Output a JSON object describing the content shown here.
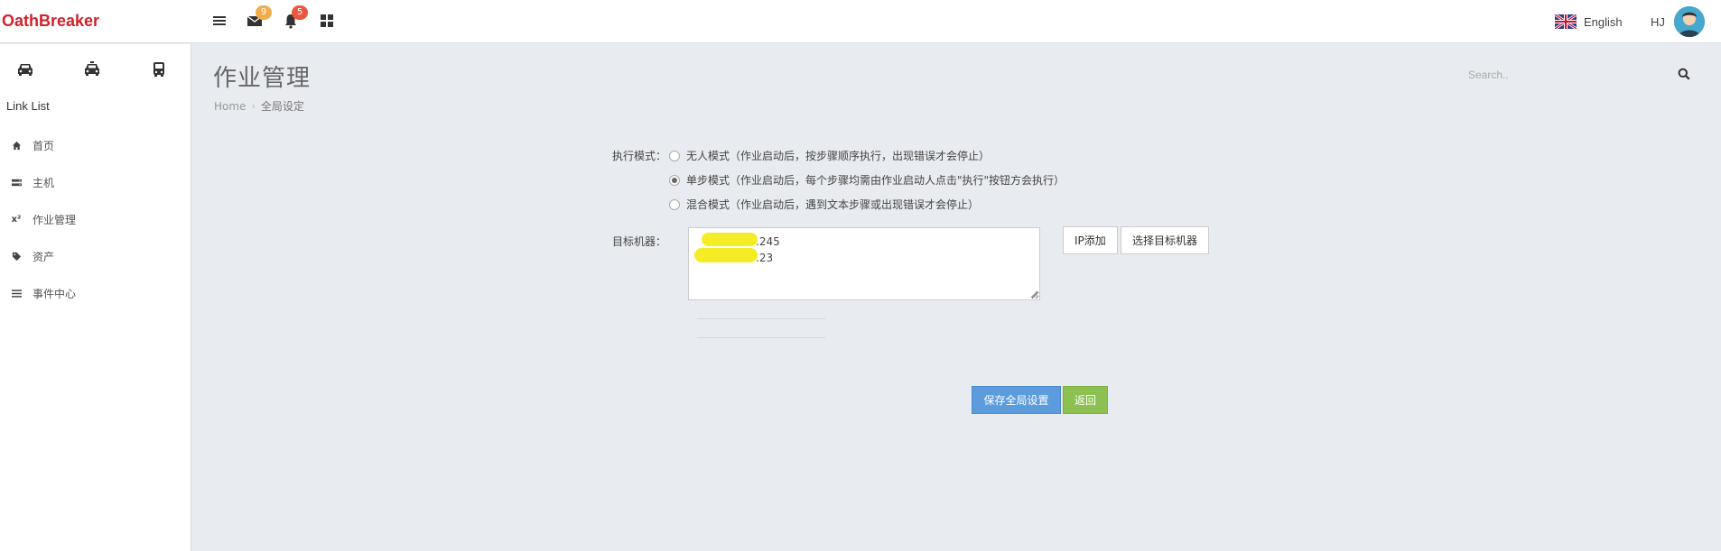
{
  "header": {
    "brand": "OathBreaker",
    "mail_count": "9",
    "notification_count": "5",
    "language": "English",
    "user_initials": "HJ"
  },
  "sidebar": {
    "heading": "Link List",
    "items": [
      {
        "label": "首页",
        "icon": "home-icon"
      },
      {
        "label": "主机",
        "icon": "server-icon"
      },
      {
        "label": "作业管理",
        "icon": "superscript-icon"
      },
      {
        "label": "资产",
        "icon": "tag-icon"
      },
      {
        "label": "事件中心",
        "icon": "list-icon"
      }
    ]
  },
  "page": {
    "title": "作业管理",
    "breadcrumb": {
      "home": "Home",
      "current": "全局设定"
    }
  },
  "search": {
    "placeholder": "Search.."
  },
  "form": {
    "mode_label": "执行模式：",
    "modes": [
      {
        "label": "无人模式（作业启动后，按步骤顺序执行，出现错误才会停止）",
        "checked": false
      },
      {
        "label": "单步模式（作业启动后，每个步骤均需由作业启动人点击\"执行\"按钮方会执行）",
        "checked": true
      },
      {
        "label": "混合模式（作业启动后，遇到文本步骤或出现错误才会停止）",
        "checked": false
      }
    ],
    "target_label": "目标机器：",
    "target_line1": ".245",
    "target_line2": ".23",
    "ip_add_button": "IP添加",
    "select_target_button": "选择目标机器",
    "save_button": "保存全局设置",
    "back_button": "返回"
  },
  "colors": {
    "brand": "#d0222b",
    "primary": "#5d9cdc",
    "success": "#8cc152",
    "badge_orange": "#f0ad4e",
    "badge_red": "#e9573f"
  }
}
